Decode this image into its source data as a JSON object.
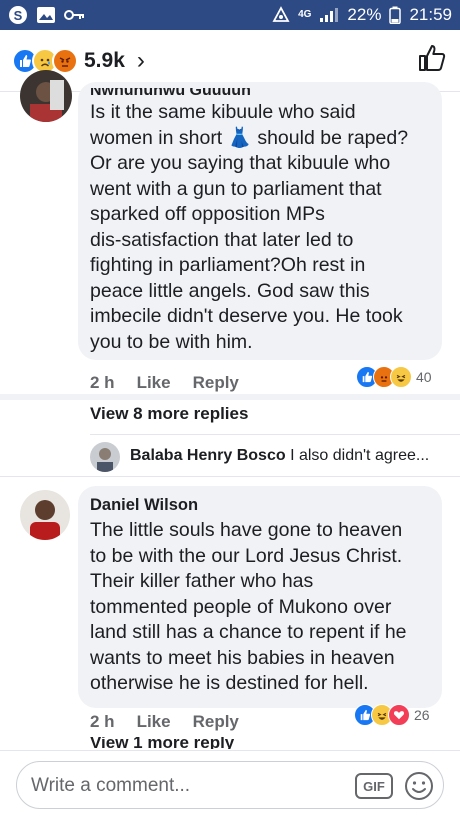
{
  "status_bar": {
    "network": "4G",
    "battery": "22%",
    "time": "21:59",
    "bg_color": "#2d4a84"
  },
  "header": {
    "reactions": [
      "like",
      "sad",
      "angry"
    ],
    "count": "5.9k",
    "chevron": "›"
  },
  "comments": [
    {
      "author_partial": "Nwhuhuhwu Guuuun",
      "text_lines": [
        "Is it the same kibuule who said",
        "women in short 👗 should be raped?",
        "Or are you saying that kibuule who",
        "went with a gun to parliament that",
        "sparked off opposition MPs",
        "dis-satisfaction that later led to",
        "fighting in parliament?Oh rest in",
        "peace little angels. God saw this",
        "imbecile didn't deserve you. He took",
        "you to be with him."
      ],
      "time": "2 h",
      "like_label": "Like",
      "reply_label": "Reply",
      "reactions": [
        "like",
        "angry",
        "haha"
      ],
      "reaction_count": "40",
      "view_more": "View 8 more replies",
      "reply_preview": {
        "author": "Balaba Henry Bosco",
        "text": "I also didn't agree..."
      }
    },
    {
      "author": "Daniel Wilson",
      "text_lines": [
        "The little souls have gone to heaven",
        "to be with the our Lord Jesus Christ.",
        "Their killer father who has",
        "tommented people of Mukono over",
        "land still has a chance to repent if he",
        "wants to meet his babies in heaven",
        "otherwise he is destined for hell."
      ],
      "time": "2 h",
      "like_label": "Like",
      "reply_label": "Reply",
      "reactions": [
        "like",
        "haha",
        "love"
      ],
      "reaction_count": "26",
      "view_more_partial": "View 1 more reply"
    }
  ],
  "composer": {
    "placeholder": "Write a comment...",
    "gif_label": "GIF"
  }
}
